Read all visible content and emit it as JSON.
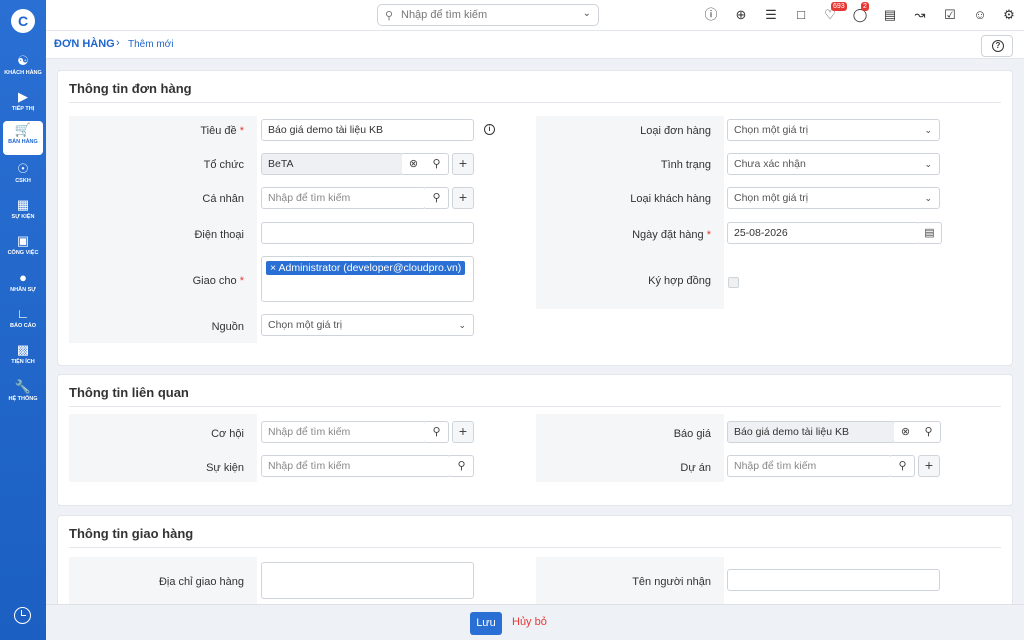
{
  "sidebar": {
    "logo": "C",
    "items": [
      {
        "label": "KHÁCH HÀNG",
        "icon": "users-icon"
      },
      {
        "label": "TIẾP THỊ",
        "icon": "megaphone-icon"
      },
      {
        "label": "BÁN HÀNG",
        "icon": "cart-icon",
        "active": true
      },
      {
        "label": "CSKH",
        "icon": "lifebuoy-icon"
      },
      {
        "label": "SỰ KIỆN",
        "icon": "calendar-icon"
      },
      {
        "label": "CÔNG VIỆC",
        "icon": "briefcase-icon"
      },
      {
        "label": "NHÂN SỰ",
        "icon": "person-icon"
      },
      {
        "label": "BÁO CÁO",
        "icon": "chart-icon"
      },
      {
        "label": "TIỆN ÍCH",
        "icon": "box-icon"
      },
      {
        "label": "HỆ THỐNG",
        "icon": "wrench-icon"
      }
    ]
  },
  "topbar": {
    "search_placeholder": "Nhập để tìm kiếm",
    "notifications_count": "693",
    "messages_count": "2"
  },
  "breadcrumb": {
    "module": "ĐƠN HÀNG",
    "page": "Thêm mới"
  },
  "order_info": {
    "title": "Thông tin đơn hàng",
    "fields": {
      "subject_label": "Tiêu đề",
      "subject_value": "Báo giá demo tài liệu KB",
      "org_label": "Tổ chức",
      "org_value": "BeTA",
      "contact_label": "Cá nhân",
      "contact_placeholder": "Nhập để tìm kiếm",
      "phone_label": "Điện thoại",
      "assigned_label": "Giao cho",
      "assigned_tag": "Administrator (developer@cloudpro.vn)",
      "source_label": "Nguồn",
      "source_value": "Chọn một giá trị",
      "order_type_label": "Loại đơn hàng",
      "order_type_value": "Chọn một giá trị",
      "status_label": "Tình trạng",
      "status_value": "Chưa xác nhận",
      "customer_type_label": "Loại khách hàng",
      "customer_type_value": "Chọn một giá trị",
      "order_date_label": "Ngày đặt hàng",
      "order_date_value": "25-08-2026",
      "contract_label": "Ký hợp đồng"
    }
  },
  "related_info": {
    "title": "Thông tin liên quan",
    "fields": {
      "opportunity_label": "Cơ hội",
      "opportunity_placeholder": "Nhập để tìm kiếm",
      "event_label": "Sự kiện",
      "event_placeholder": "Nhập để tìm kiếm",
      "quote_label": "Báo giá",
      "quote_value": "Báo giá demo tài liệu KB",
      "project_label": "Dự án",
      "project_placeholder": "Nhập để tìm kiếm"
    }
  },
  "shipping_info": {
    "title": "Thông tin giao hàng",
    "fields": {
      "address_label": "Địa chỉ giao hàng",
      "receiver_label": "Tên người nhận"
    }
  },
  "footer": {
    "save_label": "Lưu",
    "cancel_label": "Hủy bỏ"
  },
  "colors": {
    "primary": "#2a6fd3",
    "danger": "#e53935"
  }
}
